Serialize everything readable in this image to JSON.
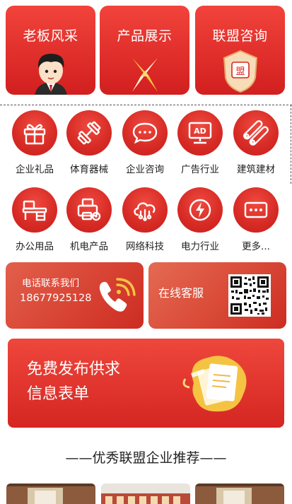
{
  "top_tiles": [
    {
      "title": "老板风采",
      "icon": "boss-cartoon-icon"
    },
    {
      "title": "产品展示",
      "icon": "product-star-icon"
    },
    {
      "title": "联盟咨询",
      "icon": "alliance-shield-icon"
    }
  ],
  "shield_text": "盟",
  "categories": [
    {
      "label": "企业礼品",
      "icon": "gift-icon"
    },
    {
      "label": "体育器械",
      "icon": "dumbbell-icon"
    },
    {
      "label": "企业咨询",
      "icon": "chat-icon"
    },
    {
      "label": "广告行业",
      "icon": "ad-board-icon"
    },
    {
      "label": "建筑建材",
      "icon": "pipes-icon"
    },
    {
      "label": "办公用品",
      "icon": "office-desk-icon"
    },
    {
      "label": "机电产品",
      "icon": "printer-gear-icon"
    },
    {
      "label": "网络科技",
      "icon": "cloud-network-icon"
    },
    {
      "label": "电力行业",
      "icon": "lightning-icon"
    },
    {
      "label": "更多...",
      "icon": "more-icon"
    }
  ],
  "ad_icon_text": "AD",
  "contact": {
    "phone_label": "电话联系我们",
    "phone_number": "18677925128",
    "online_label": "在线客服"
  },
  "banner": {
    "line1": "免费发布供求",
    "line2": "信息表单"
  },
  "section_title": "——优秀联盟企业推荐——",
  "colors": {
    "accent": "#d9261f",
    "accent_light": "#f2433b",
    "yellow": "#f5c342"
  }
}
